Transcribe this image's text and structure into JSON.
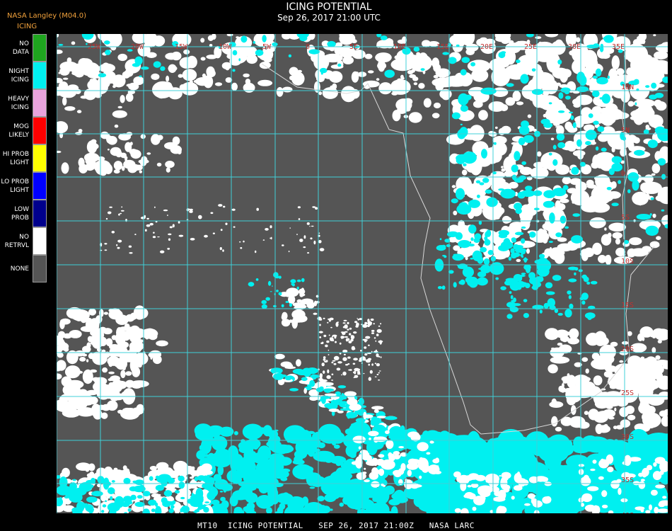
{
  "header": {
    "org": "NASA Langley (M04.0)",
    "legend_title": "ICING",
    "title": "ICING POTENTIAL",
    "subtitle": "Sep 26, 2017 21:00 UTC"
  },
  "legend": [
    {
      "l1": "NO",
      "l2": "DATA",
      "color": "#1fa51f"
    },
    {
      "l1": "NIGHT",
      "l2": "ICING",
      "color": "#00f0f0"
    },
    {
      "l1": "HEAVY",
      "l2": "ICING",
      "color": "#e8a4dc"
    },
    {
      "l1": "MOG",
      "l2": "LIKELY",
      "color": "#ff0000"
    },
    {
      "l1": "HI PROB",
      "l2": "LIGHT",
      "color": "#ffff00"
    },
    {
      "l1": "LO PROB",
      "l2": "LIGHT",
      "color": "#0000ff"
    },
    {
      "l1": "LOW",
      "l2": "PROB",
      "color": "#00008c"
    },
    {
      "l1": "NO",
      "l2": "RETRVL",
      "color": "#ffffff"
    },
    {
      "l1": "NONE",
      "l2": "",
      "color": "#555555"
    }
  ],
  "map": {
    "lon_labels": [
      "25W",
      "20W",
      "15W",
      "10W",
      "5W",
      "0",
      "5E",
      "10E",
      "15E",
      "20E",
      "25E",
      "30E",
      "35E"
    ],
    "lat_labels": [
      "10N",
      "5N",
      "0",
      "5S",
      "10S",
      "15S",
      "20S",
      "25S",
      "30S",
      "35S",
      "40S"
    ],
    "colors": {
      "background": "#555555",
      "grid": "#40d0d8",
      "grid_label": "#c03030",
      "coastline": "#d8d8d8",
      "cloud_cold": "#00f0f0",
      "cloud_retrvl": "#ffffff"
    }
  },
  "footer": "MT10  ICING POTENTIAL   SEP 26, 2017 21:00Z   NASA LARC"
}
